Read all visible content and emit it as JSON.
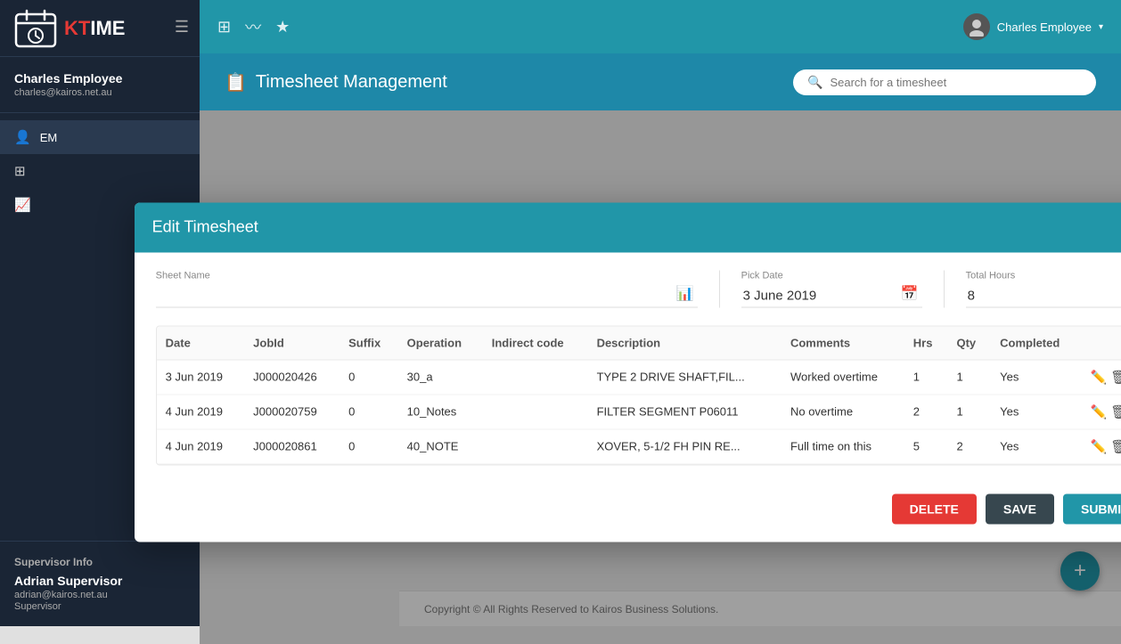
{
  "sidebar": {
    "logo_kt": "KT",
    "logo_ime": "IME",
    "user_name": "Charles Employee",
    "user_email": "charles@kairos.net.au",
    "nav_items": [
      {
        "label": "EM",
        "icon": "👤",
        "active": true
      },
      {
        "label": "Grid",
        "icon": "⊞",
        "active": false
      },
      {
        "label": "Chart",
        "icon": "📈",
        "active": false
      }
    ],
    "supervisor_label": "Supervisor Info",
    "supervisor_name": "Adrian Supervisor",
    "supervisor_email": "adrian@kairos.net.au",
    "supervisor_role": "Supervisor"
  },
  "topnav": {
    "icons": [
      "⊞",
      "📈",
      "★"
    ],
    "user_name": "Charles Employee",
    "chevron": "▾"
  },
  "page_header": {
    "title": "Timesheet Management",
    "search_placeholder": "Search for a timesheet"
  },
  "modal": {
    "title": "Edit Timesheet",
    "close_label": "×",
    "sheet_name_label": "Sheet Name",
    "sheet_name_value": "",
    "pick_date_label": "Pick Date",
    "pick_date_value": "3 June 2019",
    "total_hours_label": "Total Hours",
    "total_hours_value": "8",
    "table": {
      "columns": [
        "Date",
        "JobId",
        "Suffix",
        "Operation",
        "Indirect code",
        "Description",
        "Comments",
        "Hrs",
        "Qty",
        "Completed"
      ],
      "rows": [
        {
          "date": "3 Jun 2019",
          "jobid": "J000020426",
          "suffix": "0",
          "operation": "30_a",
          "indirect_code": "",
          "description": "TYPE 2 DRIVE SHAFT,FIL...",
          "comments": "Worked overtime",
          "hrs": "1",
          "qty": "1",
          "completed": "Yes"
        },
        {
          "date": "4 Jun 2019",
          "jobid": "J000020759",
          "suffix": "0",
          "operation": "10_Notes",
          "indirect_code": "",
          "description": "FILTER SEGMENT P06011",
          "comments": "No overtime",
          "hrs": "2",
          "qty": "1",
          "completed": "Yes"
        },
        {
          "date": "4 Jun 2019",
          "jobid": "J000020861",
          "suffix": "0",
          "operation": "40_NOTE",
          "indirect_code": "",
          "description": "XOVER, 5-1/2 FH PIN RE...",
          "comments": "Full time on this",
          "hrs": "5",
          "qty": "2",
          "completed": "Yes"
        }
      ]
    },
    "btn_delete": "DELETE",
    "btn_save": "SAVE",
    "btn_submit": "SUBMIT"
  },
  "footer": {
    "text": "Copyright © All Rights Reserved to Kairos Business Solutions."
  },
  "fab_label": "+"
}
